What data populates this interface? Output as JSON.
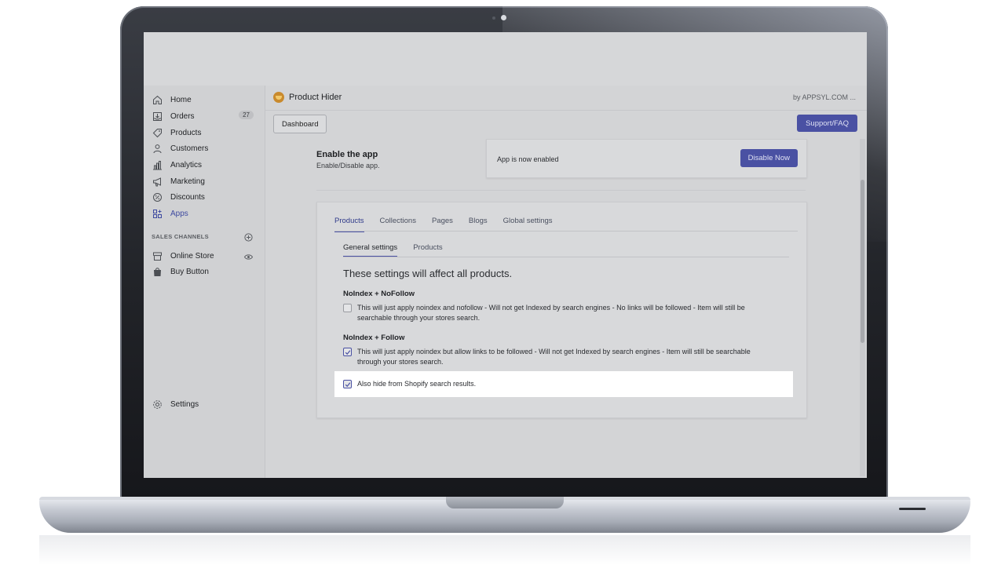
{
  "sidebar": {
    "items": [
      {
        "label": "Home",
        "icon": "home-icon"
      },
      {
        "label": "Orders",
        "icon": "orders-icon",
        "badge": "27"
      },
      {
        "label": "Products",
        "icon": "tag-icon"
      },
      {
        "label": "Customers",
        "icon": "person-icon"
      },
      {
        "label": "Analytics",
        "icon": "bar-chart-icon"
      },
      {
        "label": "Marketing",
        "icon": "megaphone-icon"
      },
      {
        "label": "Discounts",
        "icon": "discount-icon"
      },
      {
        "label": "Apps",
        "icon": "apps-icon",
        "active": true
      }
    ],
    "sales_channels_label": "SALES CHANNELS",
    "channels": [
      {
        "label": "Online Store",
        "icon": "store-icon"
      },
      {
        "label": "Buy Button",
        "icon": "shopping-bag-icon"
      }
    ],
    "settings_label": "Settings"
  },
  "appbar": {
    "title": "Product Hider",
    "by": "by APPSYL.COM ..."
  },
  "toolbar": {
    "dashboard_label": "Dashboard",
    "support_label": "Support/FAQ"
  },
  "enable": {
    "title": "Enable the app",
    "description": "Enable/Disable app.",
    "status": "App is now enabled",
    "disable_label": "Disable Now"
  },
  "tabs": [
    "Products",
    "Collections",
    "Pages",
    "Blogs",
    "Global settings"
  ],
  "subtabs": [
    "General settings",
    "Products"
  ],
  "settings": {
    "heading": "These settings will affect all products.",
    "groups": [
      {
        "label": "NoIndex + NoFollow",
        "option": "This will just apply noindex and nofollow - Will not get Indexed by search engines - No links will be followed - Item will still be searchable through your stores search.",
        "checked": false
      },
      {
        "label": "NoIndex + Follow",
        "option": "This will just apply noindex but allow links to be followed - Will not get Indexed by search engines - Item will still be searchable through your stores search.",
        "checked": true
      }
    ],
    "hide_search_label": "Also hide from Shopify search results.",
    "hide_search_checked": true
  },
  "colors": {
    "accent": "#4a51a3",
    "active_nav": "#3e4aa0"
  }
}
